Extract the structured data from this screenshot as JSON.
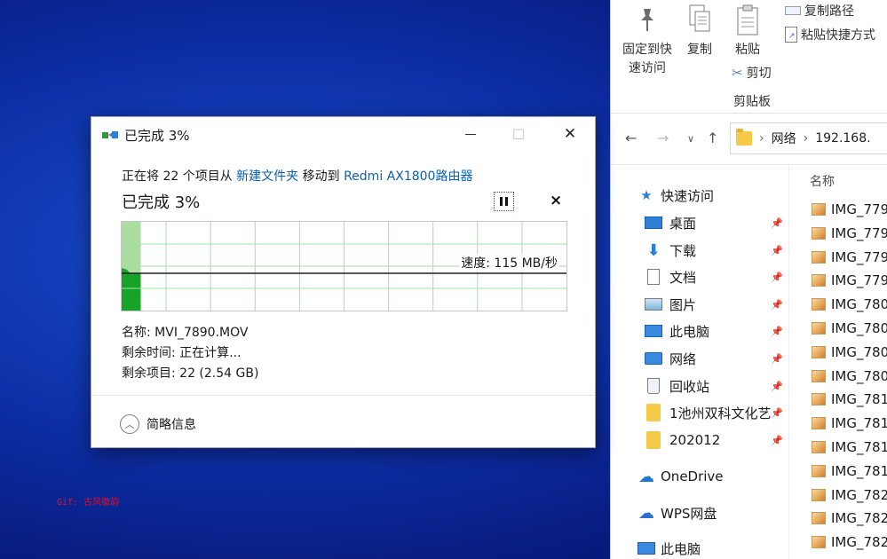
{
  "watermark": "Gif: 古风徽韵",
  "dialog": {
    "title": "已完成 3%",
    "window_controls": {
      "minimize": "—",
      "maximize": "☐",
      "close": "✕"
    },
    "desc_prefix": "正在将 22 个项目从 ",
    "desc_source": "新建文件夹",
    "desc_middle": " 移动到 ",
    "desc_dest": "Redmi AX1800路由器",
    "percent_text": "已完成 3%",
    "cancel_symbol": "×",
    "progress_fraction": 0.03,
    "speed_text": "速度: 115 MB/秒",
    "name_line": "名称: MVI_7890.MOV",
    "time_line": "剩余时间: 正在计算...",
    "items_line": "剩余项目: 22 (2.54 GB)",
    "details_toggle": "简略信息",
    "colors": {
      "fill": "#16a328",
      "fill_light": "#a9dea0",
      "grid": "#a6dfa6",
      "link": "#0a5fb4"
    }
  },
  "explorer": {
    "ribbon": {
      "pin_label_1": "固定到快",
      "pin_label_2": "速访问",
      "copy_label": "复制",
      "paste_label": "粘贴",
      "cut_label": "剪切",
      "copy_path_label": "复制路径",
      "paste_shortcut_label": "粘贴快捷方式",
      "group_label": "剪贴板"
    },
    "nav_buttons": {
      "back": "←",
      "forward": "→",
      "recent": "∨",
      "up": "↑"
    },
    "address": {
      "sep1": "›",
      "part1": "网络",
      "sep2": "›",
      "part2": "192.168."
    },
    "navpane": {
      "quick_access": "快速访问",
      "items": [
        {
          "label": "桌面"
        },
        {
          "label": "下载"
        },
        {
          "label": "文档"
        },
        {
          "label": "图片"
        },
        {
          "label": "此电脑"
        },
        {
          "label": "网络"
        },
        {
          "label": "回收站"
        },
        {
          "label": "1池州双科文化艺"
        },
        {
          "label": "202012"
        }
      ],
      "onedrive": "OneDrive",
      "wps": "WPS网盘",
      "thispc": "此电脑"
    },
    "filelist": {
      "column_name": "名称",
      "files": [
        "IMG_779",
        "IMG_779",
        "IMG_779",
        "IMG_779",
        "IMG_780",
        "IMG_780",
        "IMG_780",
        "IMG_780",
        "IMG_781",
        "IMG_781",
        "IMG_781",
        "IMG_781",
        "IMG_782",
        "IMG_782",
        "IMG_782"
      ]
    }
  }
}
